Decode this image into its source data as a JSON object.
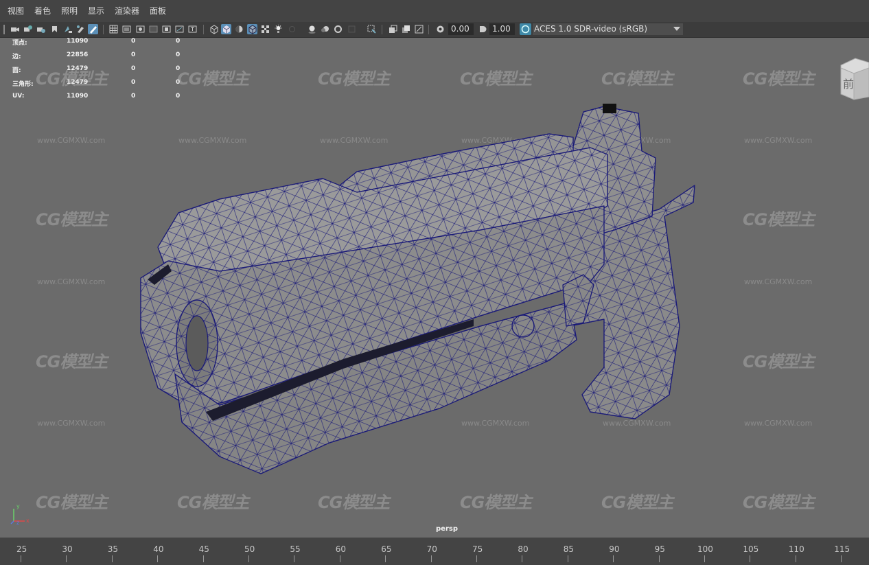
{
  "menu": [
    "视图",
    "着色",
    "照明",
    "显示",
    "渲染器",
    "面板"
  ],
  "toolbar": {
    "exposure_value": "0.00",
    "gamma_value": "1.00",
    "color_space": "ACES 1.0 SDR-video (sRGB)"
  },
  "hud": {
    "rows": [
      {
        "label": "顶点:",
        "v1": "11090",
        "v2": "0",
        "v3": "0"
      },
      {
        "label": "边:",
        "v1": "22856",
        "v2": "0",
        "v3": "0"
      },
      {
        "label": "面:",
        "v1": "12479",
        "v2": "0",
        "v3": "0"
      },
      {
        "label": "三角形:",
        "v1": "12479",
        "v2": "0",
        "v3": "0"
      },
      {
        "label": "UV:",
        "v1": "11090",
        "v2": "0",
        "v3": "0"
      }
    ]
  },
  "viewcube_face": "前",
  "camera_label": "persp",
  "axis": {
    "x": "x",
    "y": "y",
    "z": "z"
  },
  "watermark": {
    "logo": "CG模型主",
    "url": "www.CGMXW.com"
  },
  "timeline": {
    "labels": [
      "25",
      "30",
      "35",
      "40",
      "45",
      "50",
      "55",
      "60",
      "65",
      "70",
      "75",
      "80",
      "85",
      "90",
      "95",
      "100",
      "105",
      "110",
      "115"
    ]
  },
  "colors": {
    "viewport_bg": "#6b6b6b",
    "wireframe": "#1a1a78",
    "mesh_fill": "#8c8c8c",
    "ui_bg": "#444444",
    "active_tool": "#5b8fb7"
  }
}
